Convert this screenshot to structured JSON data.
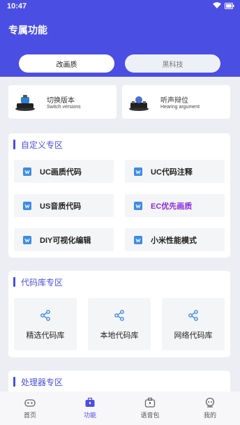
{
  "status_bar": {
    "time": "10:47"
  },
  "header": {
    "title": "专属功能"
  },
  "pills": {
    "active": "改画质",
    "inactive": "黑科技"
  },
  "version_cards": [
    {
      "title": "切换版本",
      "subtitle": "Switch versions"
    },
    {
      "title": "听声辩位",
      "subtitle": "Hearing argument"
    }
  ],
  "custom_zone": {
    "title": "自定义专区",
    "items": [
      "UC画质代码",
      "UC代码注释",
      "US音质代码",
      "EC优先画质",
      "DIY可视化编辑",
      "小米性能模式"
    ]
  },
  "library_zone": {
    "title": "代码库专区",
    "items": [
      "精选代码库",
      "本地代码库",
      "网络代码库"
    ]
  },
  "processor_zone": {
    "title": "处理器专区"
  },
  "bottom_nav": [
    {
      "label": "首页",
      "icon": "gamepad-icon"
    },
    {
      "label": "功能",
      "icon": "toolbox-icon"
    },
    {
      "label": "语音包",
      "icon": "briefcase-icon"
    },
    {
      "label": "我的",
      "icon": "robot-icon"
    }
  ],
  "colors": {
    "accent": "#4a4ee3",
    "highlight": "#8a2ce0",
    "background": "#eceef3"
  }
}
